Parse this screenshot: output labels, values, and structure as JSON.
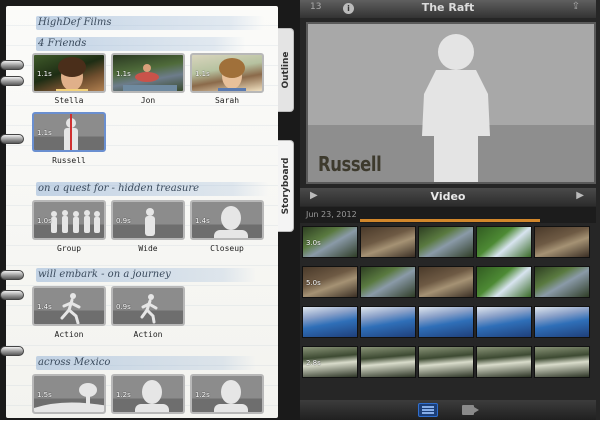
{
  "notebook": {
    "title": "HighDef Films",
    "sections": [
      {
        "heading": "4 Friends",
        "shots": [
          {
            "label": "Stella",
            "duration": "1.1s"
          },
          {
            "label": "Jon",
            "duration": "1.1s"
          },
          {
            "label": "Sarah",
            "duration": "1.1s"
          },
          {
            "label": "Russell",
            "duration": "1.1s",
            "selected": true
          }
        ]
      },
      {
        "heading": "on a quest for - hidden treasure",
        "shots": [
          {
            "label": "Group",
            "duration": "1.0s"
          },
          {
            "label": "Wide",
            "duration": "0.9s"
          },
          {
            "label": "Closeup",
            "duration": "1.4s"
          }
        ]
      },
      {
        "heading": "will embark - on a journey",
        "shots": [
          {
            "label": "Action",
            "duration": "1.4s"
          },
          {
            "label": "Action",
            "duration": "0.9s"
          }
        ]
      },
      {
        "heading": "across Mexico",
        "shots": [
          {
            "label": "",
            "duration": "1.5s"
          },
          {
            "label": "",
            "duration": "1.2s"
          },
          {
            "label": "",
            "duration": "1.2s"
          }
        ]
      }
    ]
  },
  "tabs": {
    "outline": "Outline",
    "storyboard": "Storyboard"
  },
  "viewer": {
    "title": "The Raft",
    "counter": "13",
    "info_glyph": "i",
    "share_glyph": "⇪",
    "preview_name": "Russell"
  },
  "video_browser": {
    "label": "Video",
    "play_left_glyph": "▶",
    "play_right_glyph": "▶",
    "date": "Jun 23, 2012",
    "clip_durations": [
      "3.0s",
      "5.0s",
      "",
      "",
      "2.8s"
    ]
  },
  "colors": {
    "accent": "#d2872b",
    "selected_border": "#6a8fd0",
    "highlight_blue": "#96b4d7"
  }
}
